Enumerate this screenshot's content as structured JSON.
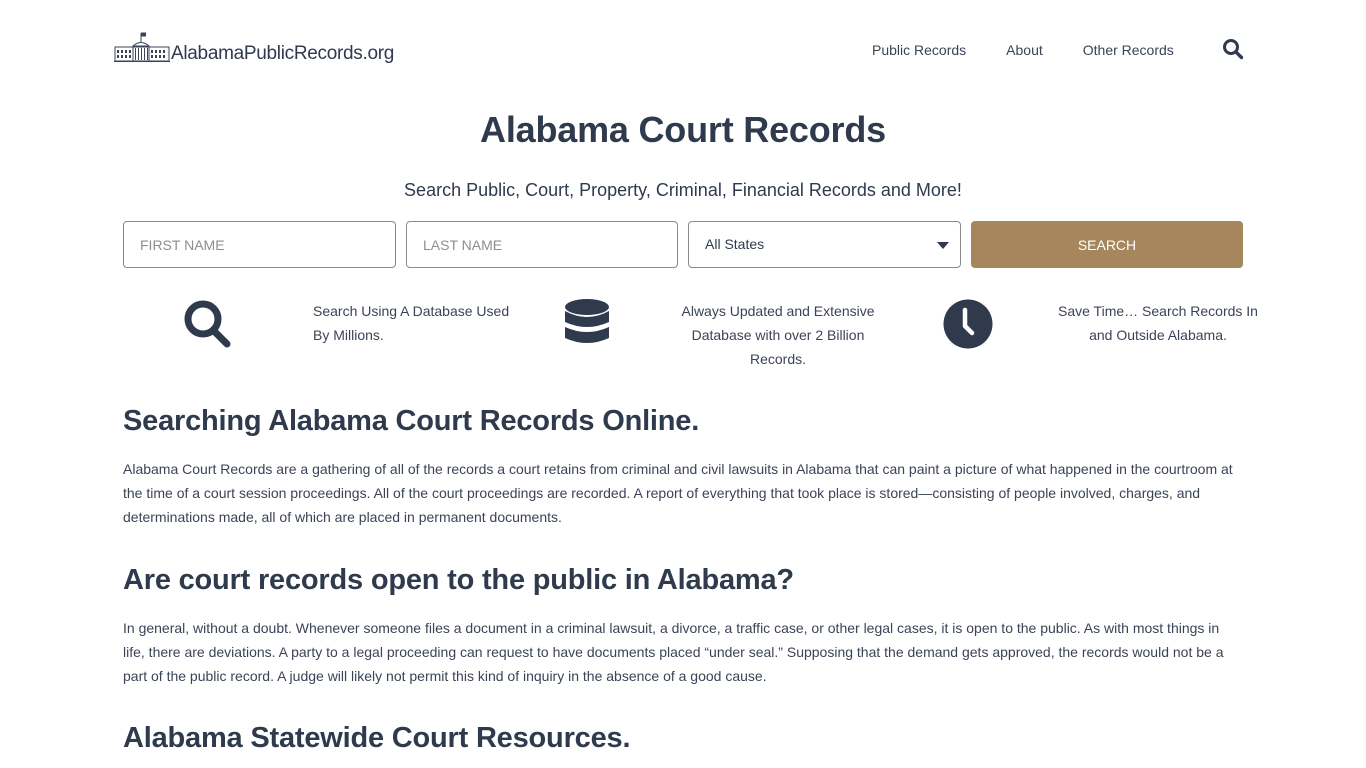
{
  "header": {
    "logo_text": "AlabamaPublicRecords.org",
    "logo_icon": "capitol-building-icon",
    "nav": [
      {
        "label": "Public Records"
      },
      {
        "label": "About"
      },
      {
        "label": "Other Records"
      }
    ],
    "search_icon": "search-icon"
  },
  "hero": {
    "title": "Alabama Court Records",
    "subtitle": "Search Public, Court, Property, Criminal, Financial Records and More!"
  },
  "search_form": {
    "first_name_placeholder": "FIRST NAME",
    "first_name_value": "",
    "last_name_placeholder": "LAST NAME",
    "last_name_value": "",
    "state_selected": "All States",
    "search_button": "SEARCH",
    "button_color": "#a6865d"
  },
  "features": [
    {
      "icon": "search-icon",
      "text": "Search Using A Database Used By Millions."
    },
    {
      "icon": "database-icon",
      "text": "Always Updated and Extensive Database with over 2 Billion Records."
    },
    {
      "icon": "clock-icon",
      "text": "Save Time… Search Records In and Outside Alabama."
    }
  ],
  "sections": [
    {
      "heading": "Searching Alabama Court Records Online.",
      "body": "Alabama Court Records are a gathering of all of the records a court retains from criminal and civil lawsuits in Alabama that can paint a picture of what happened in the courtroom at the time of a court session proceedings. All of the court proceedings are recorded. A report of everything that took place is stored—consisting of people involved, charges, and determinations made, all of which are placed in permanent documents."
    },
    {
      "heading": "Are court records open to the public in Alabama?",
      "body": "In general, without a doubt. Whenever someone files a document in a criminal lawsuit, a divorce, a traffic case, or other legal cases, it is open to the public. As with most things in life, there are deviations. A party to a legal proceeding can request to have documents placed “under seal.” Supposing that the demand gets approved, the records would not be a part of the public record. A judge will likely not permit this kind of inquiry in the absence of a good cause."
    },
    {
      "heading": "Alabama Statewide Court Resources."
    }
  ],
  "colors": {
    "text_dark": "#2f3a4d",
    "accent": "#a6865d"
  }
}
